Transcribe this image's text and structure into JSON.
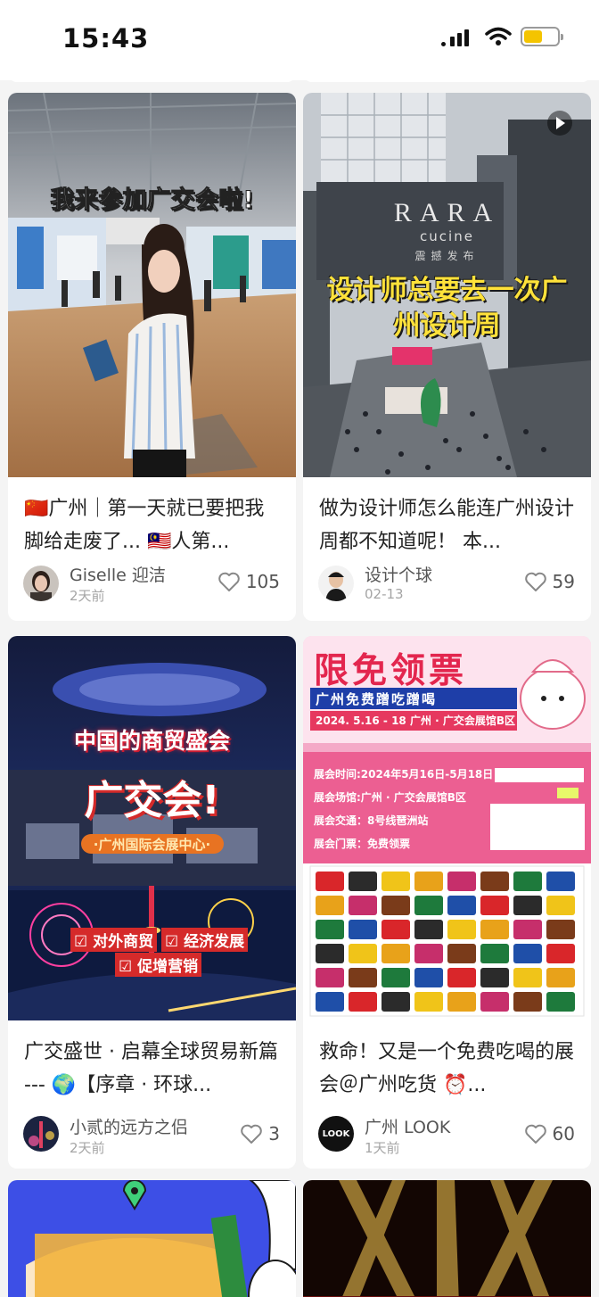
{
  "status_bar": {
    "time": "15:43"
  },
  "cards": [
    {
      "overlay": "我来参加广交会啦!",
      "title": "🇨🇳广州｜第一天就已要把我脚给走废了... 🇲🇾人第...",
      "author": "Giselle 迎洁",
      "date": "2天前",
      "likes": "105"
    },
    {
      "overlay": "设计师总要去一次广州设计周",
      "sign_brand": "RARA",
      "sign_sub": "cucine",
      "sign_cn": "震撼发布",
      "title": "做为设计师怎么能连广州设计周都不知道呢！ 本...",
      "author": "设计个球",
      "date": "02-13",
      "likes": "59"
    },
    {
      "overlay_line1": "中国的商贸盛会",
      "overlay_line2": "广交会!",
      "overlay_line3": "·广州国际会展中心·",
      "tag1": "☑ 对外商贸",
      "tag2": "☑ 经济发展",
      "tag3": "☑ 促增营销",
      "title": "广交盛世 · 启幕全球贸易新篇 --- 🌍【序章 · 环球...",
      "author": "小贰的远方之侣",
      "date": "2天前",
      "likes": "3"
    },
    {
      "poster_title": "限免领票",
      "poster_subtitle": "广州免费蹭吃蹭喝",
      "poster_date": "2024. 5.16 - 18 广州 · 广交会展馆B区",
      "info1": "展会时间:2024年5月16日-5月18日",
      "info2": "展会场馆:广州 · 广交会展馆B区",
      "info3": "展会交通：8号线琶洲站",
      "info4": "展会门票：免费领票",
      "title": "救命！又是一个免费吃喝的展会＠广州吃货 ⏰...",
      "author": "广州 LOOK",
      "avatar_text": "LOOK",
      "date": "1天前",
      "likes": "60"
    }
  ],
  "colors": {
    "like": "#888888",
    "poster_pink": "#e83a6a",
    "battery": "#f4c400"
  }
}
